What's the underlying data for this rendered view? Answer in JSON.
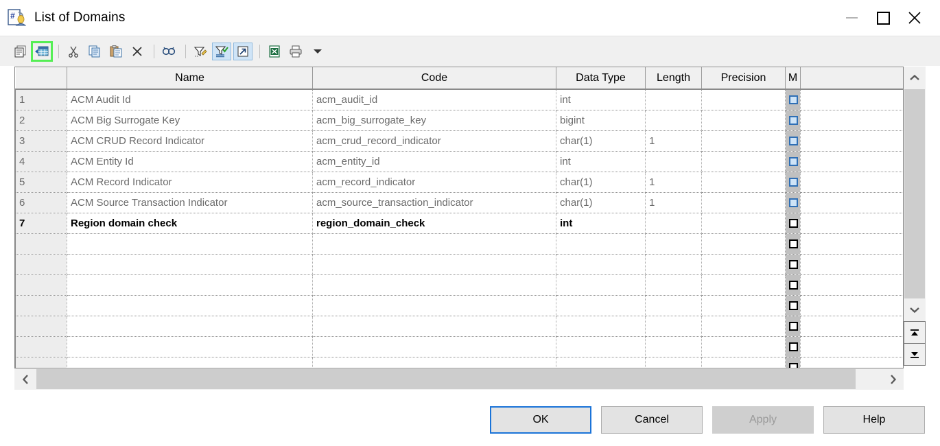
{
  "window": {
    "title": "List of Domains",
    "app_icon": "domain-document-icon",
    "minimize_label": "Minimize",
    "maximize_label": "Maximize",
    "close_label": "Close"
  },
  "toolbar": {
    "buttons": [
      {
        "name": "properties-icon",
        "label": "Properties",
        "state": "normal"
      },
      {
        "name": "insert-row-icon",
        "label": "Insert a Row",
        "state": "highlighted"
      },
      {
        "name": "cut-icon",
        "label": "Cut",
        "state": "normal"
      },
      {
        "name": "copy-icon",
        "label": "Copy",
        "state": "normal"
      },
      {
        "name": "paste-icon",
        "label": "Paste",
        "state": "normal"
      },
      {
        "name": "delete-icon",
        "label": "Delete",
        "state": "normal"
      },
      {
        "name": "find-icon",
        "label": "Find",
        "state": "normal"
      },
      {
        "name": "customize-columns-icon",
        "label": "Customize Columns and Filter",
        "state": "normal"
      },
      {
        "name": "apply-filter-icon",
        "label": "Apply Filter",
        "state": "toggled"
      },
      {
        "name": "open-detail-icon",
        "label": "Open Detail",
        "state": "toggled"
      },
      {
        "name": "export-excel-icon",
        "label": "Export to Excel",
        "state": "normal"
      },
      {
        "name": "print-icon",
        "label": "Print",
        "state": "normal"
      },
      {
        "name": "chevron-down-icon",
        "label": "More",
        "state": "normal"
      }
    ]
  },
  "grid": {
    "columns": [
      {
        "key": "num",
        "label": ""
      },
      {
        "key": "name",
        "label": "Name"
      },
      {
        "key": "code",
        "label": "Code"
      },
      {
        "key": "datatype",
        "label": "Data Type"
      },
      {
        "key": "length",
        "label": "Length"
      },
      {
        "key": "precision",
        "label": "Precision"
      },
      {
        "key": "mandatory",
        "label": "M"
      },
      {
        "key": "tail",
        "label": ""
      }
    ],
    "rows": [
      {
        "num": "1",
        "name": "ACM Audit Id",
        "code": "acm_audit_id",
        "datatype": "int",
        "length": "",
        "precision": "",
        "mandatory": false,
        "current": false
      },
      {
        "num": "2",
        "name": "ACM Big Surrogate Key",
        "code": "acm_big_surrogate_key",
        "datatype": "bigint",
        "length": "",
        "precision": "",
        "mandatory": false,
        "current": false
      },
      {
        "num": "3",
        "name": "ACM CRUD Record Indicator",
        "code": "acm_crud_record_indicator",
        "datatype": "char(1)",
        "length": "1",
        "precision": "",
        "mandatory": false,
        "current": false
      },
      {
        "num": "4",
        "name": "ACM Entity Id",
        "code": "acm_entity_id",
        "datatype": "int",
        "length": "",
        "precision": "",
        "mandatory": false,
        "current": false
      },
      {
        "num": "5",
        "name": "ACM Record Indicator",
        "code": "acm_record_indicator",
        "datatype": "char(1)",
        "length": "1",
        "precision": "",
        "mandatory": false,
        "current": false
      },
      {
        "num": "6",
        "name": "ACM Source Transaction Indicator",
        "code": "acm_source_transaction_indicator",
        "datatype": "char(1)",
        "length": "1",
        "precision": "",
        "mandatory": false,
        "current": false
      },
      {
        "num": "7",
        "name": "Region domain check",
        "code": "region_domain_check",
        "datatype": "int",
        "length": "",
        "precision": "",
        "mandatory": false,
        "current": true
      },
      {
        "num": "",
        "name": "",
        "code": "",
        "datatype": "",
        "length": "",
        "precision": "",
        "mandatory": false,
        "current": false
      },
      {
        "num": "",
        "name": "",
        "code": "",
        "datatype": "",
        "length": "",
        "precision": "",
        "mandatory": false,
        "current": false
      },
      {
        "num": "",
        "name": "",
        "code": "",
        "datatype": "",
        "length": "",
        "precision": "",
        "mandatory": false,
        "current": false
      },
      {
        "num": "",
        "name": "",
        "code": "",
        "datatype": "",
        "length": "",
        "precision": "",
        "mandatory": false,
        "current": false
      },
      {
        "num": "",
        "name": "",
        "code": "",
        "datatype": "",
        "length": "",
        "precision": "",
        "mandatory": false,
        "current": false
      },
      {
        "num": "",
        "name": "",
        "code": "",
        "datatype": "",
        "length": "",
        "precision": "",
        "mandatory": false,
        "current": false
      },
      {
        "num": "",
        "name": "",
        "code": "",
        "datatype": "",
        "length": "",
        "precision": "",
        "mandatory": false,
        "current": false
      },
      {
        "num": "",
        "name": "",
        "code": "",
        "datatype": "",
        "length": "",
        "precision": "",
        "mandatory": false,
        "current": false
      }
    ]
  },
  "scrollbars": {
    "vertical": {
      "up_label": "Scroll Up",
      "down_label": "Scroll Down",
      "top_label": "Go to First Row",
      "bottom_label": "Go to Last Row"
    },
    "horizontal": {
      "left_label": "Scroll Left",
      "right_label": "Scroll Right"
    }
  },
  "footer": {
    "ok": "OK",
    "cancel": "Cancel",
    "apply": "Apply",
    "help": "Help"
  },
  "colors": {
    "highlight_green": "#55ee55",
    "focus_blue": "#1a73d8",
    "toggle_blue": "#cfe4f7",
    "mandatory_col_gray": "#c0c0c0"
  }
}
